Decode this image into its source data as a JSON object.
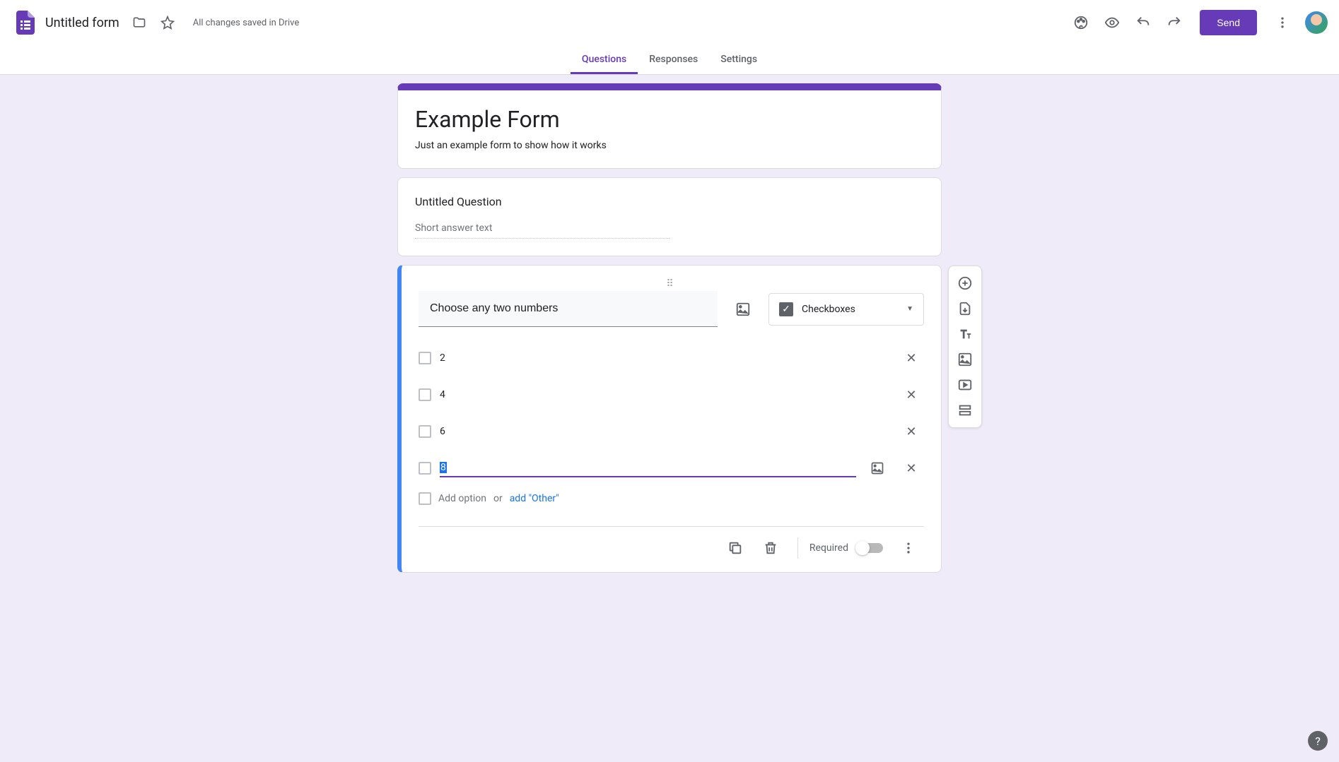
{
  "header": {
    "doc_title": "Untitled form",
    "save_status": "All changes saved in Drive",
    "send_label": "Send"
  },
  "tabs": {
    "questions": "Questions",
    "responses": "Responses",
    "settings": "Settings",
    "active": "questions"
  },
  "form": {
    "title": "Example Form",
    "description": "Just an example form to show how it works"
  },
  "question1": {
    "title": "Untitled Question",
    "placeholder": "Short answer text"
  },
  "question2": {
    "title": "Choose any two numbers",
    "type_label": "Checkboxes",
    "options": [
      "2",
      "4",
      "6",
      "8"
    ],
    "editing_index": 3,
    "add_option": "Add option",
    "or": "or",
    "add_other": "add \"Other\"",
    "required_label": "Required",
    "required": false
  },
  "colors": {
    "accent": "#673ab7",
    "active_blue": "#4285f4",
    "link_blue": "#1a73e8"
  }
}
